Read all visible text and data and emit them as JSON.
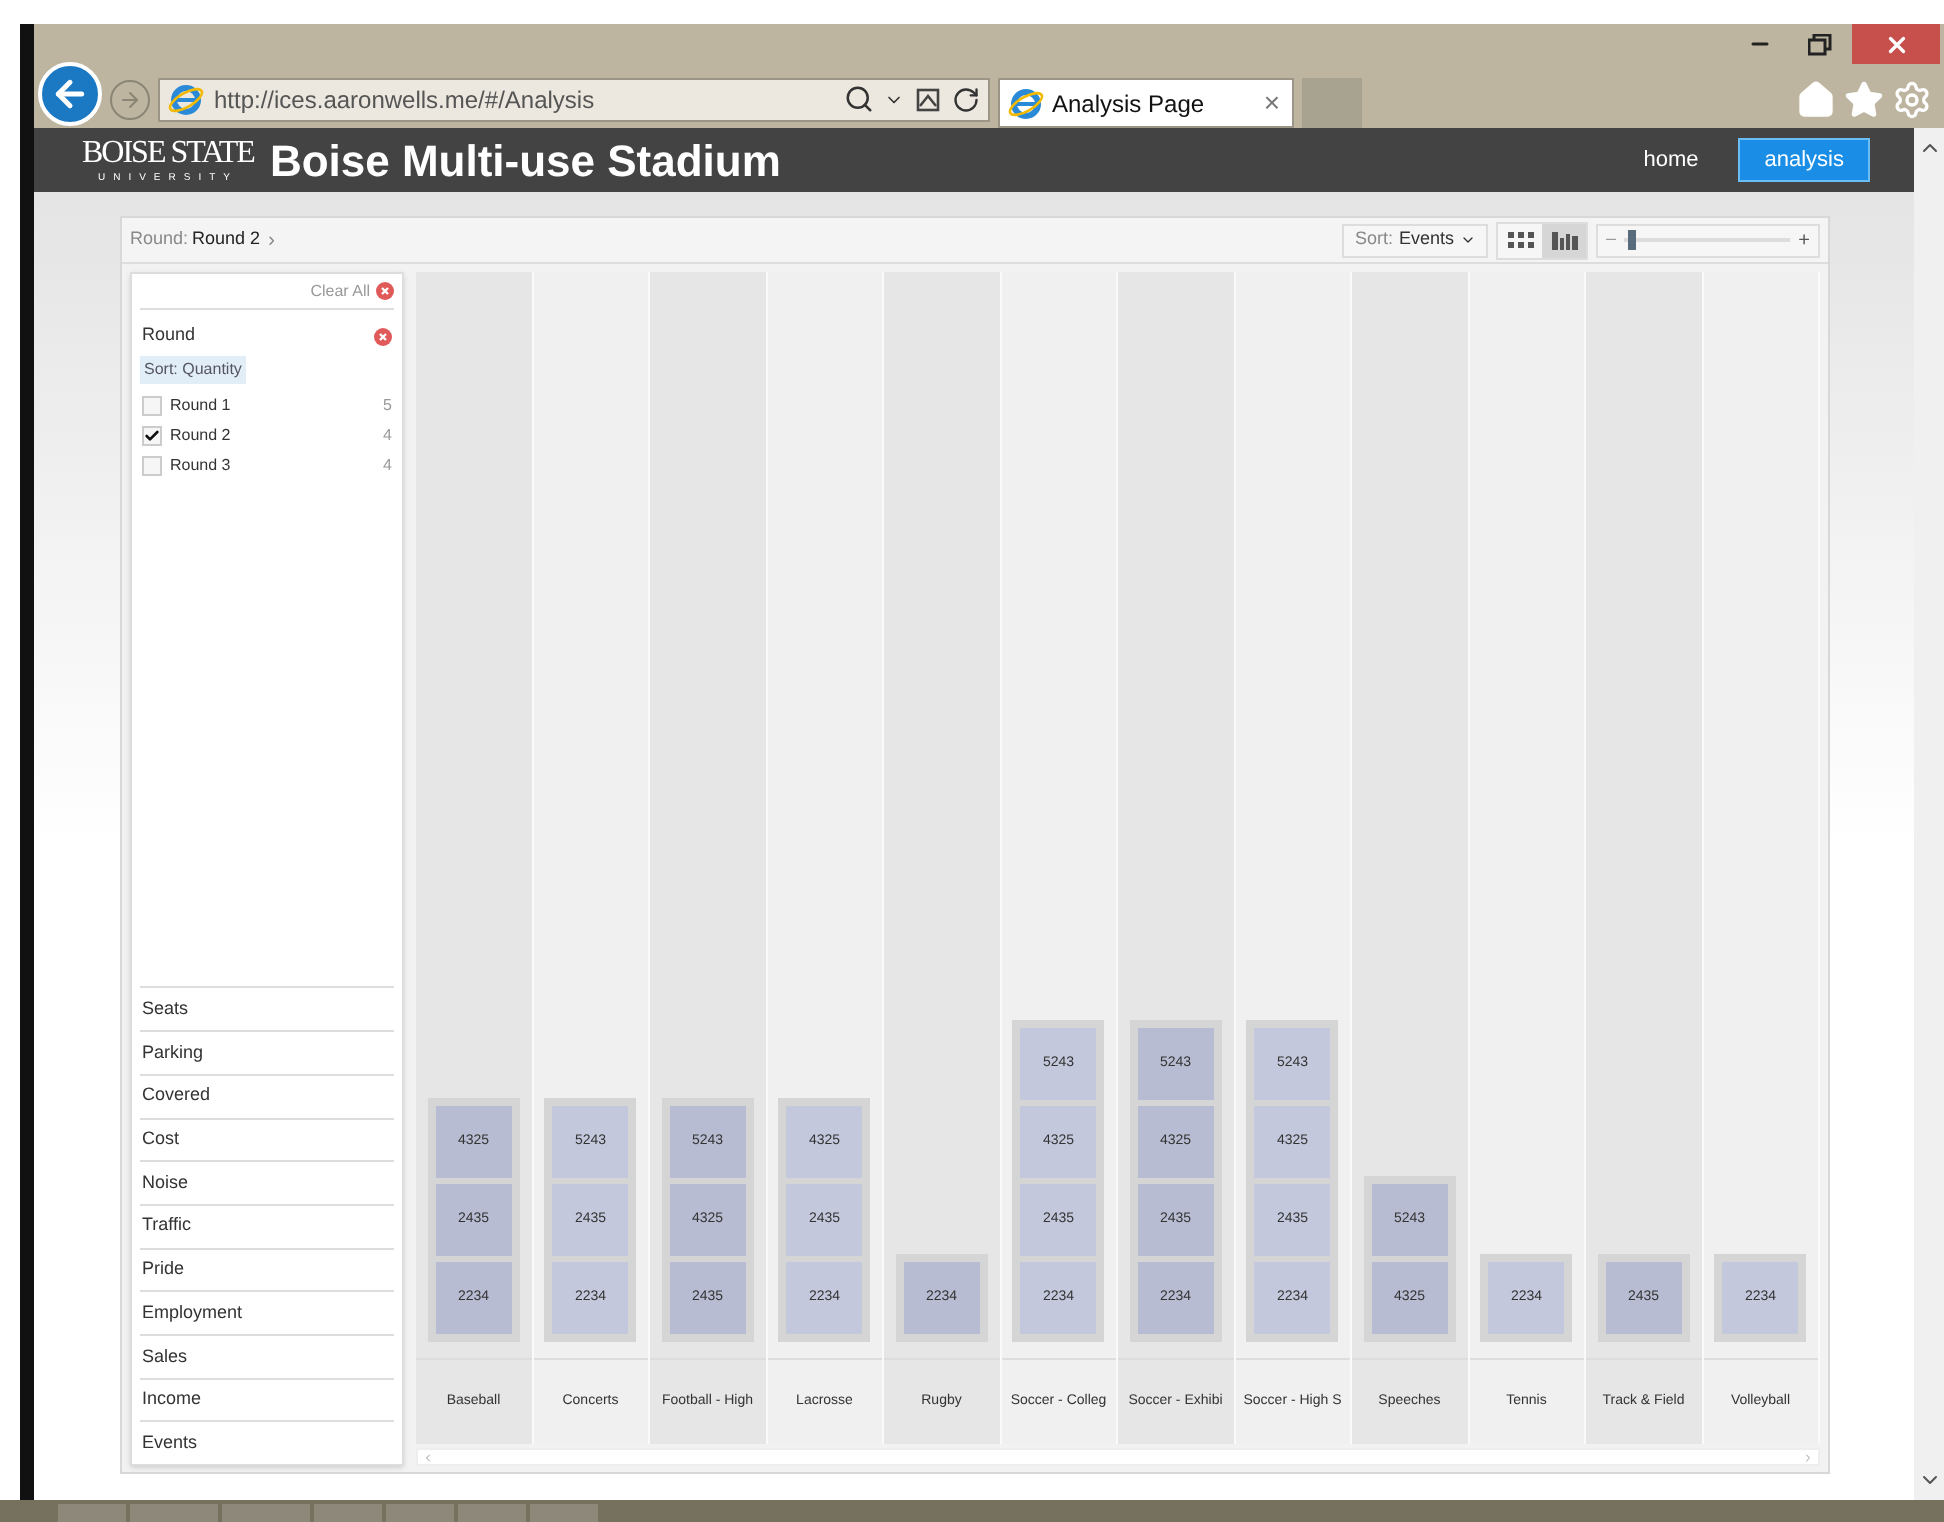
{
  "browser": {
    "address": "http://ices.aaronwells.me/#/Analysis",
    "tab_title": "Analysis Page",
    "tab_close": "×"
  },
  "header": {
    "logo_top": "BOISE STATE",
    "logo_bottom": "UNIVERSITY",
    "title": "Boise Multi-use Stadium",
    "nav": [
      {
        "label": "home",
        "selected": false
      },
      {
        "label": "analysis",
        "selected": true
      }
    ]
  },
  "toolbar": {
    "crumb_label": "Round:",
    "crumb_value": "Round 2",
    "crumb_arrow": "›",
    "sort_label": "Sort:",
    "sort_value": "Events",
    "views": [
      {
        "kind": "grid",
        "selected": false
      },
      {
        "kind": "bars",
        "selected": true
      }
    ],
    "zoom_minus": "–",
    "zoom_plus": "+",
    "zoom": {
      "level": 0.05
    }
  },
  "filters": {
    "clear_all": "Clear All",
    "group": "Round",
    "sort": "Sort: Quantity",
    "options": [
      {
        "label": "Round 1",
        "count": "5",
        "checked": false
      },
      {
        "label": "Round 2",
        "count": "4",
        "checked": true
      },
      {
        "label": "Round 3",
        "count": "4",
        "checked": false
      }
    ],
    "categories": [
      "Seats",
      "Parking",
      "Covered",
      "Cost",
      "Noise",
      "Traffic",
      "Pride",
      "Employment",
      "Sales",
      "Income",
      "Events"
    ]
  },
  "events": [
    {
      "name": "Baseball",
      "values": [
        "4325",
        "2435",
        "2234"
      ]
    },
    {
      "name": "Concerts",
      "values": [
        "5243",
        "2435",
        "2234"
      ]
    },
    {
      "name": "Football - High",
      "values": [
        "5243",
        "4325",
        "2435"
      ]
    },
    {
      "name": "Lacrosse",
      "values": [
        "4325",
        "2435",
        "2234"
      ]
    },
    {
      "name": "Rugby",
      "values": [
        "2234"
      ]
    },
    {
      "name": "Soccer - Colleg",
      "values": [
        "5243",
        "4325",
        "2435",
        "2234"
      ]
    },
    {
      "name": "Soccer - Exhibi",
      "values": [
        "5243",
        "4325",
        "2435",
        "2234"
      ]
    },
    {
      "name": "Soccer - High S",
      "values": [
        "5243",
        "4325",
        "2435",
        "2234"
      ]
    },
    {
      "name": "Speeches",
      "values": [
        "5243",
        "4325"
      ]
    },
    {
      "name": "Tennis",
      "values": [
        "2234"
      ]
    },
    {
      "name": "Track & Field",
      "values": [
        "2435"
      ]
    },
    {
      "name": "Volleyball",
      "values": [
        "2234"
      ]
    }
  ]
}
